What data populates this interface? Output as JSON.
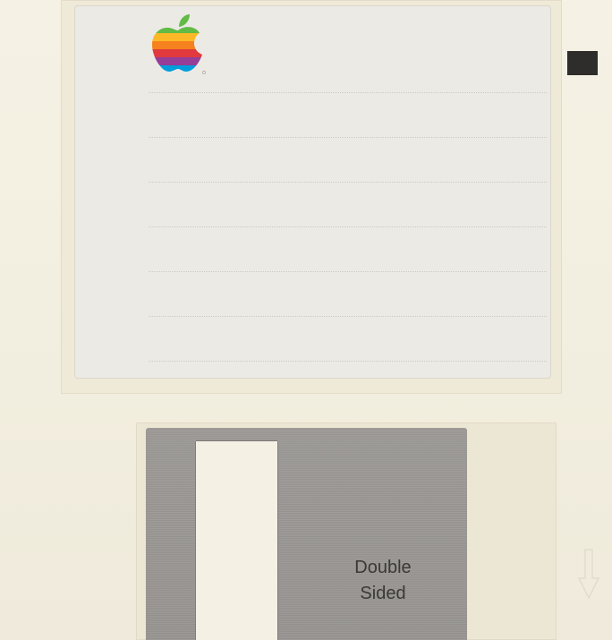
{
  "disk": {
    "brand_icon": "apple-rainbow-logo",
    "label_rule_count": 7,
    "shutter": {
      "text_line_1": "Double",
      "text_line_2": "Sided"
    },
    "colors": {
      "body": "#f3efe2",
      "label": "#eceae5",
      "shutter": "#9a9794",
      "write_protect": "#2e2d2b",
      "logo_stripes": [
        "#61bb46",
        "#fdb827",
        "#f5821f",
        "#e03a3e",
        "#963d97",
        "#009ddc"
      ]
    }
  }
}
